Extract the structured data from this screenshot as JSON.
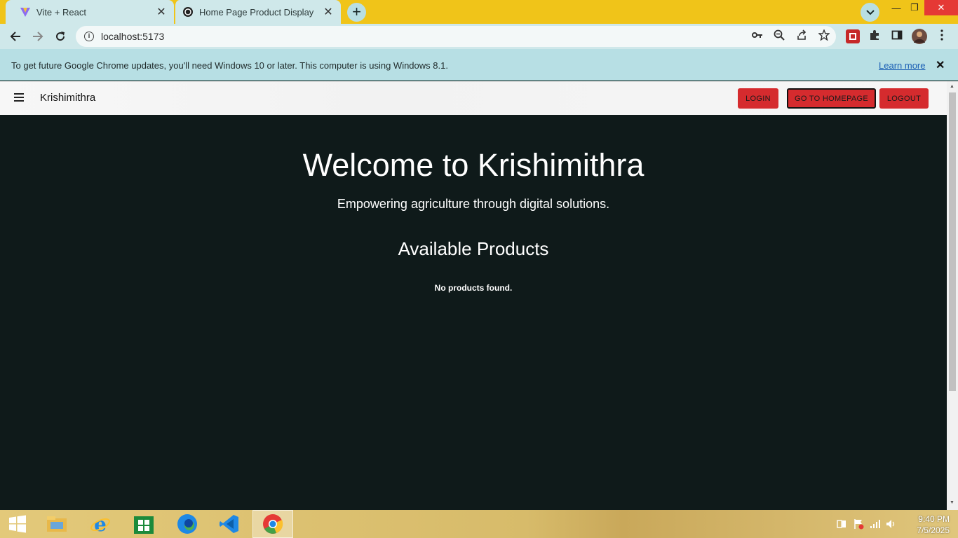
{
  "browser": {
    "tabs": [
      {
        "title": "Vite + React",
        "icon": "vite-icon"
      },
      {
        "title": "Home Page Product Display",
        "icon": "openai-icon"
      }
    ],
    "new_tab_label": "+",
    "url": "localhost:5173"
  },
  "infobar": {
    "message": "To get future Google Chrome updates, you'll need Windows 10 or later. This computer is using Windows 8.1.",
    "link": "Learn more",
    "close": "✕"
  },
  "app": {
    "brand": "Krishimithra",
    "buttons": {
      "login": "LOGIN",
      "homepage": "GO TO HOMEPAGE",
      "logout": "LOGOUT"
    },
    "accent_color": "#d52b2e"
  },
  "main": {
    "title": "Welcome to Krishimithra",
    "subtitle": "Empowering agriculture through digital solutions.",
    "section_title": "Available Products",
    "empty_message": "No products found."
  },
  "taskbar": {
    "time": "9:40 PM",
    "date": "7/5/2025"
  }
}
